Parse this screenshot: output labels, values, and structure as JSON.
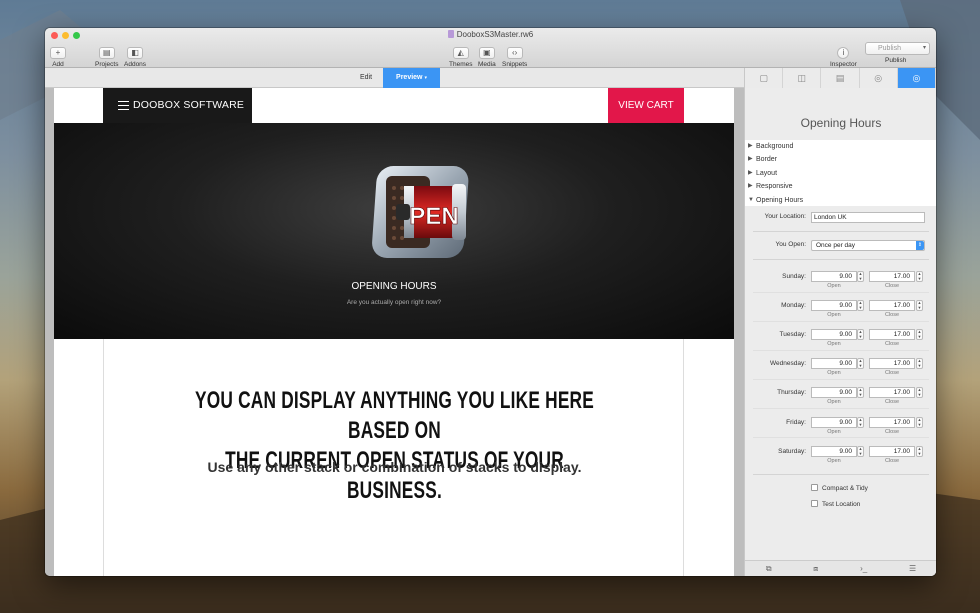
{
  "window": {
    "title": "DooboxS3Master.rw6",
    "toolbar": {
      "add": "Add",
      "projects": "Projects",
      "addons": "Addons",
      "themes": "Themes",
      "media": "Media",
      "snippets": "Snippets",
      "inspector": "Inspector",
      "publish_button": "Publish",
      "publish": "Publish"
    },
    "mode_tabs": {
      "edit": "Edit",
      "preview": "Preview"
    }
  },
  "page": {
    "brand": "DOOBOX SOFTWARE",
    "cart": "VIEW CART",
    "hero": {
      "icon_text": "PEN",
      "title": "OPENING HOURS",
      "subtitle": "Are you actually open right now?"
    },
    "headline_1": "YOU CAN DISPLAY ANYTHING YOU LIKE HERE BASED ON",
    "headline_2": "THE CURRENT OPEN STATUS OF YOUR BUSINESS.",
    "subline": "Use any other stack or combination of stacks to display."
  },
  "inspector": {
    "title": "Opening Hours",
    "sections": [
      "Background",
      "Border",
      "Layout",
      "Responsive",
      "Opening Hours"
    ],
    "location_label": "Your Location:",
    "location_value": "London UK",
    "open_label": "You Open:",
    "open_value": "Once per day",
    "open_caption": "Open",
    "close_caption": "Close",
    "days": [
      {
        "name": "Sunday:",
        "open": "9.00",
        "close": "17.00"
      },
      {
        "name": "Monday:",
        "open": "9.00",
        "close": "17.00"
      },
      {
        "name": "Tuesday:",
        "open": "9.00",
        "close": "17.00"
      },
      {
        "name": "Wednesday:",
        "open": "9.00",
        "close": "17.00"
      },
      {
        "name": "Thursday:",
        "open": "9.00",
        "close": "17.00"
      },
      {
        "name": "Friday:",
        "open": "9.00",
        "close": "17.00"
      },
      {
        "name": "Saturday:",
        "open": "9.00",
        "close": "17.00"
      }
    ],
    "compact": "Compact & Tidy",
    "test_location": "Test Location"
  },
  "colors": {
    "accent": "#3b95f4",
    "cart": "#e2174a",
    "brand_bg": "#191919"
  }
}
